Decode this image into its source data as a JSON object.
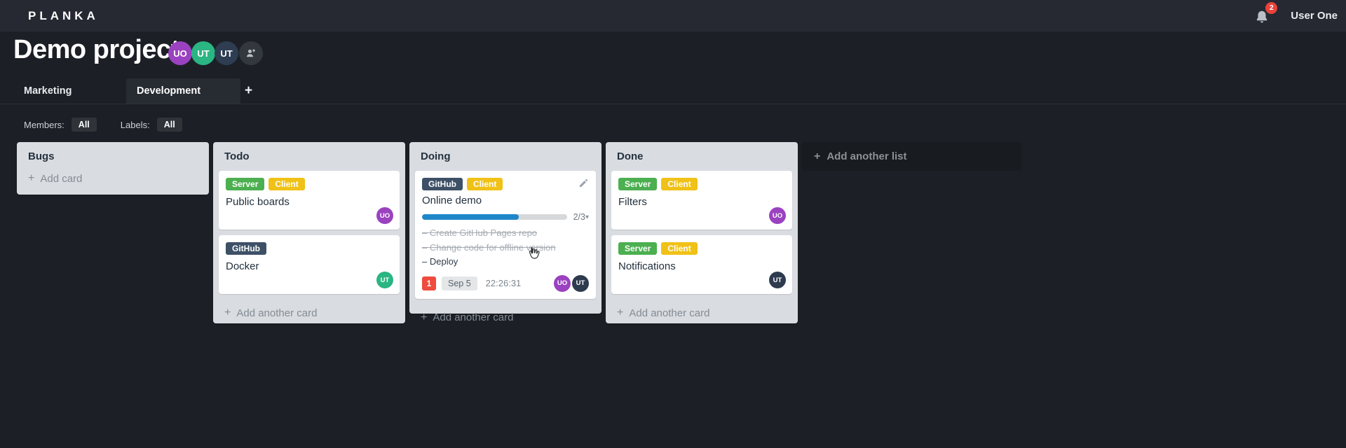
{
  "header": {
    "logo": "PLANKA",
    "user_name": "User One",
    "notification_count": "2"
  },
  "project": {
    "title": "Demo project",
    "members": [
      {
        "initials": "UO",
        "color": "#9b42c0"
      },
      {
        "initials": "UT",
        "color": "#2ab583"
      },
      {
        "initials": "UT",
        "color": "#2e3d52"
      }
    ]
  },
  "tabs": {
    "items": [
      {
        "label": "Marketing",
        "active": false
      },
      {
        "label": "Development",
        "active": true
      }
    ]
  },
  "filters": {
    "members_label": "Members:",
    "members_value": "All",
    "labels_label": "Labels:",
    "labels_value": "All"
  },
  "board": {
    "add_list_label": "Add another list",
    "lists": [
      {
        "name": "Bugs",
        "add_card_label": "Add card",
        "cards": []
      },
      {
        "name": "Todo",
        "add_card_label": "Add another card",
        "cards": [
          {
            "title": "Public boards",
            "labels": [
              {
                "text": "Server",
                "color": "#4caf50"
              },
              {
                "text": "Client",
                "color": "#f0c117"
              }
            ],
            "members": [
              {
                "initials": "UO",
                "color": "#9b42c0"
              }
            ]
          },
          {
            "title": "Docker",
            "labels": [
              {
                "text": "GitHub",
                "color": "#3d5066"
              }
            ],
            "members": [
              {
                "initials": "UT",
                "color": "#2ab583"
              }
            ]
          }
        ]
      },
      {
        "name": "Doing",
        "add_card_label": "Add another card",
        "cards": [
          {
            "title": "Online demo",
            "labels": [
              {
                "text": "GitHub",
                "color": "#3d5066"
              },
              {
                "text": "Client",
                "color": "#f0c117"
              }
            ],
            "progress": {
              "done": 2,
              "total": 3,
              "label": "2/3",
              "percent": 67,
              "color": "#1f87c9"
            },
            "tasks": [
              {
                "text": "Create GitHub Pages repo",
                "completed": true
              },
              {
                "text": "Change code for offline version",
                "completed": true
              },
              {
                "text": "Deploy",
                "completed": false
              }
            ],
            "notification_count": "1",
            "due_date": "Sep 5",
            "timer": "22:26:31",
            "members": [
              {
                "initials": "UO",
                "color": "#9b42c0"
              },
              {
                "initials": "UT",
                "color": "#2e3b4e"
              }
            ]
          }
        ]
      },
      {
        "name": "Done",
        "add_card_label": "Add another card",
        "cards": [
          {
            "title": "Filters",
            "labels": [
              {
                "text": "Server",
                "color": "#4caf50"
              },
              {
                "text": "Client",
                "color": "#f0c117"
              }
            ],
            "members": [
              {
                "initials": "UO",
                "color": "#9b42c0"
              }
            ]
          },
          {
            "title": "Notifications",
            "labels": [
              {
                "text": "Server",
                "color": "#4caf50"
              },
              {
                "text": "Client",
                "color": "#f0c117"
              }
            ],
            "members": [
              {
                "initials": "UT",
                "color": "#2e3b4e"
              }
            ]
          }
        ]
      }
    ]
  },
  "icons": {
    "plus": "+",
    "caret_down": "▾"
  },
  "colors": {
    "header_bg": "#262931",
    "board_bg": "#1c2026",
    "list_bg": "#d9dce0",
    "badge_red": "#ef4b3e",
    "progress_blue": "#1f87c9"
  }
}
